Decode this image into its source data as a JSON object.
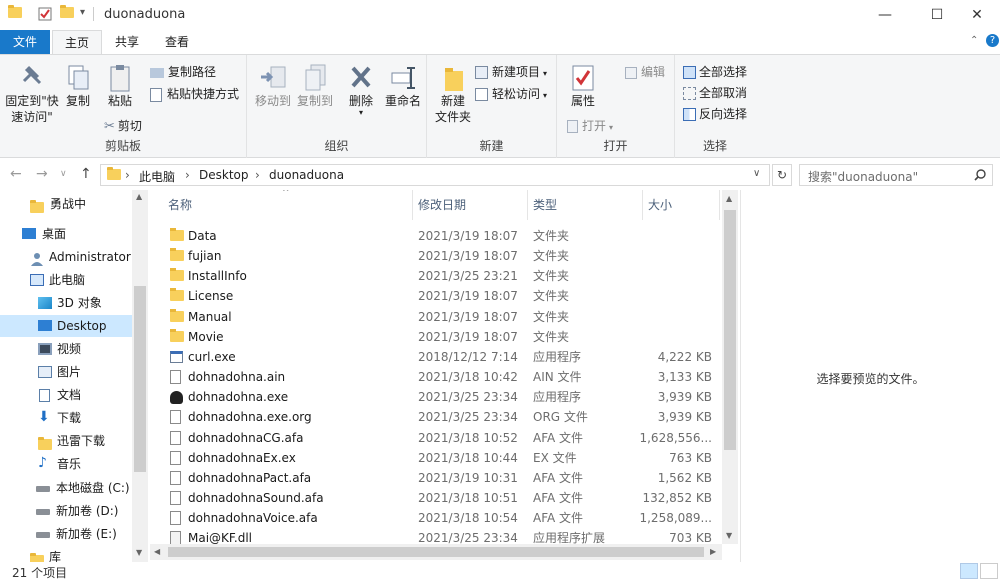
{
  "window": {
    "title": "duonaduona",
    "minimize": "—",
    "maximize": "☐",
    "close": "✕"
  },
  "ribbon_tabs": [
    "文件",
    "主页",
    "共享",
    "查看"
  ],
  "ribbon": {
    "clipboard": {
      "pin": "固定到\"快\n速访问\"",
      "copy": "复制",
      "paste": "粘贴",
      "copy_path": "复制路径",
      "paste_shortcut": "粘贴快捷方式",
      "cut": "剪切",
      "title": "剪贴板"
    },
    "organize": {
      "move_to": "移动到",
      "copy_to": "复制到",
      "delete": "删除",
      "rename": "重命名",
      "title": "组织"
    },
    "new": {
      "new_folder": "新建\n文件夹",
      "new_item": "新建项目",
      "easy_access": "轻松访问",
      "title": "新建"
    },
    "open": {
      "properties": "属性",
      "open": "打开",
      "edit": "编辑",
      "title": "打开"
    },
    "select": {
      "select_all": "全部选择",
      "select_none": "全部取消",
      "invert": "反向选择",
      "title": "选择"
    }
  },
  "address": {
    "crumbs": [
      "此电脑",
      "Desktop",
      "duonaduona"
    ],
    "search_placeholder": "搜索\"duonaduona\""
  },
  "nav": [
    {
      "label": "勇战中",
      "icon": "folder-icon"
    },
    {
      "label": "桌面",
      "icon": "desktop-icon"
    },
    {
      "label": "Administrator",
      "icon": "user-icon"
    },
    {
      "label": "此电脑",
      "icon": "computer-icon"
    },
    {
      "label": "3D 对象",
      "icon": "cube-icon"
    },
    {
      "label": "Desktop",
      "icon": "desktop-icon"
    },
    {
      "label": "视频",
      "icon": "video-icon"
    },
    {
      "label": "图片",
      "icon": "picture-icon"
    },
    {
      "label": "文档",
      "icon": "document-icon"
    },
    {
      "label": "下载",
      "icon": "download-icon"
    },
    {
      "label": "迅雷下载",
      "icon": "folder-icon"
    },
    {
      "label": "音乐",
      "icon": "music-icon"
    },
    {
      "label": "本地磁盘 (C:)",
      "icon": "drive-icon"
    },
    {
      "label": "新加卷 (D:)",
      "icon": "drive-icon"
    },
    {
      "label": "新加卷 (E:)",
      "icon": "drive-icon"
    },
    {
      "label": "库",
      "icon": "library-icon"
    }
  ],
  "columns": [
    "名称",
    "修改日期",
    "类型",
    "大小"
  ],
  "files": [
    {
      "name": "Data",
      "date": "2021/3/19 18:07",
      "type": "文件夹",
      "size": "",
      "icon": "folder"
    },
    {
      "name": "fujian",
      "date": "2021/3/19 18:07",
      "type": "文件夹",
      "size": "",
      "icon": "folder"
    },
    {
      "name": "InstallInfo",
      "date": "2021/3/25 23:21",
      "type": "文件夹",
      "size": "",
      "icon": "folder"
    },
    {
      "name": "License",
      "date": "2021/3/19 18:07",
      "type": "文件夹",
      "size": "",
      "icon": "folder"
    },
    {
      "name": "Manual",
      "date": "2021/3/19 18:07",
      "type": "文件夹",
      "size": "",
      "icon": "folder"
    },
    {
      "name": "Movie",
      "date": "2021/3/19 18:07",
      "type": "文件夹",
      "size": "",
      "icon": "folder"
    },
    {
      "name": "curl.exe",
      "date": "2018/12/12 7:14",
      "type": "应用程序",
      "size": "4,222 KB",
      "icon": "exe"
    },
    {
      "name": "dohnadohna.ain",
      "date": "2021/3/18 10:42",
      "type": "AIN 文件",
      "size": "3,133 KB",
      "icon": "doc"
    },
    {
      "name": "dohnadohna.exe",
      "date": "2021/3/25 23:34",
      "type": "应用程序",
      "size": "3,939 KB",
      "icon": "cat"
    },
    {
      "name": "dohnadohna.exe.org",
      "date": "2021/3/25 23:34",
      "type": "ORG 文件",
      "size": "3,939 KB",
      "icon": "doc"
    },
    {
      "name": "dohnadohnaCG.afa",
      "date": "2021/3/18 10:52",
      "type": "AFA 文件",
      "size": "1,628,556...",
      "icon": "doc"
    },
    {
      "name": "dohnadohnaEx.ex",
      "date": "2021/3/18 10:44",
      "type": "EX 文件",
      "size": "763 KB",
      "icon": "doc"
    },
    {
      "name": "dohnadohnaPact.afa",
      "date": "2021/3/19 10:31",
      "type": "AFA 文件",
      "size": "1,562 KB",
      "icon": "doc"
    },
    {
      "name": "dohnadohnaSound.afa",
      "date": "2021/3/18 10:51",
      "type": "AFA 文件",
      "size": "132,852 KB",
      "icon": "doc"
    },
    {
      "name": "dohnadohnaVoice.afa",
      "date": "2021/3/18 10:54",
      "type": "AFA 文件",
      "size": "1,258,089...",
      "icon": "doc"
    },
    {
      "name": "Mai@KF.dll",
      "date": "2021/3/25 23:34",
      "type": "应用程序扩展",
      "size": "703 KB",
      "icon": "dll"
    }
  ],
  "preview_text": "选择要预览的文件。",
  "status": "21 个项目"
}
